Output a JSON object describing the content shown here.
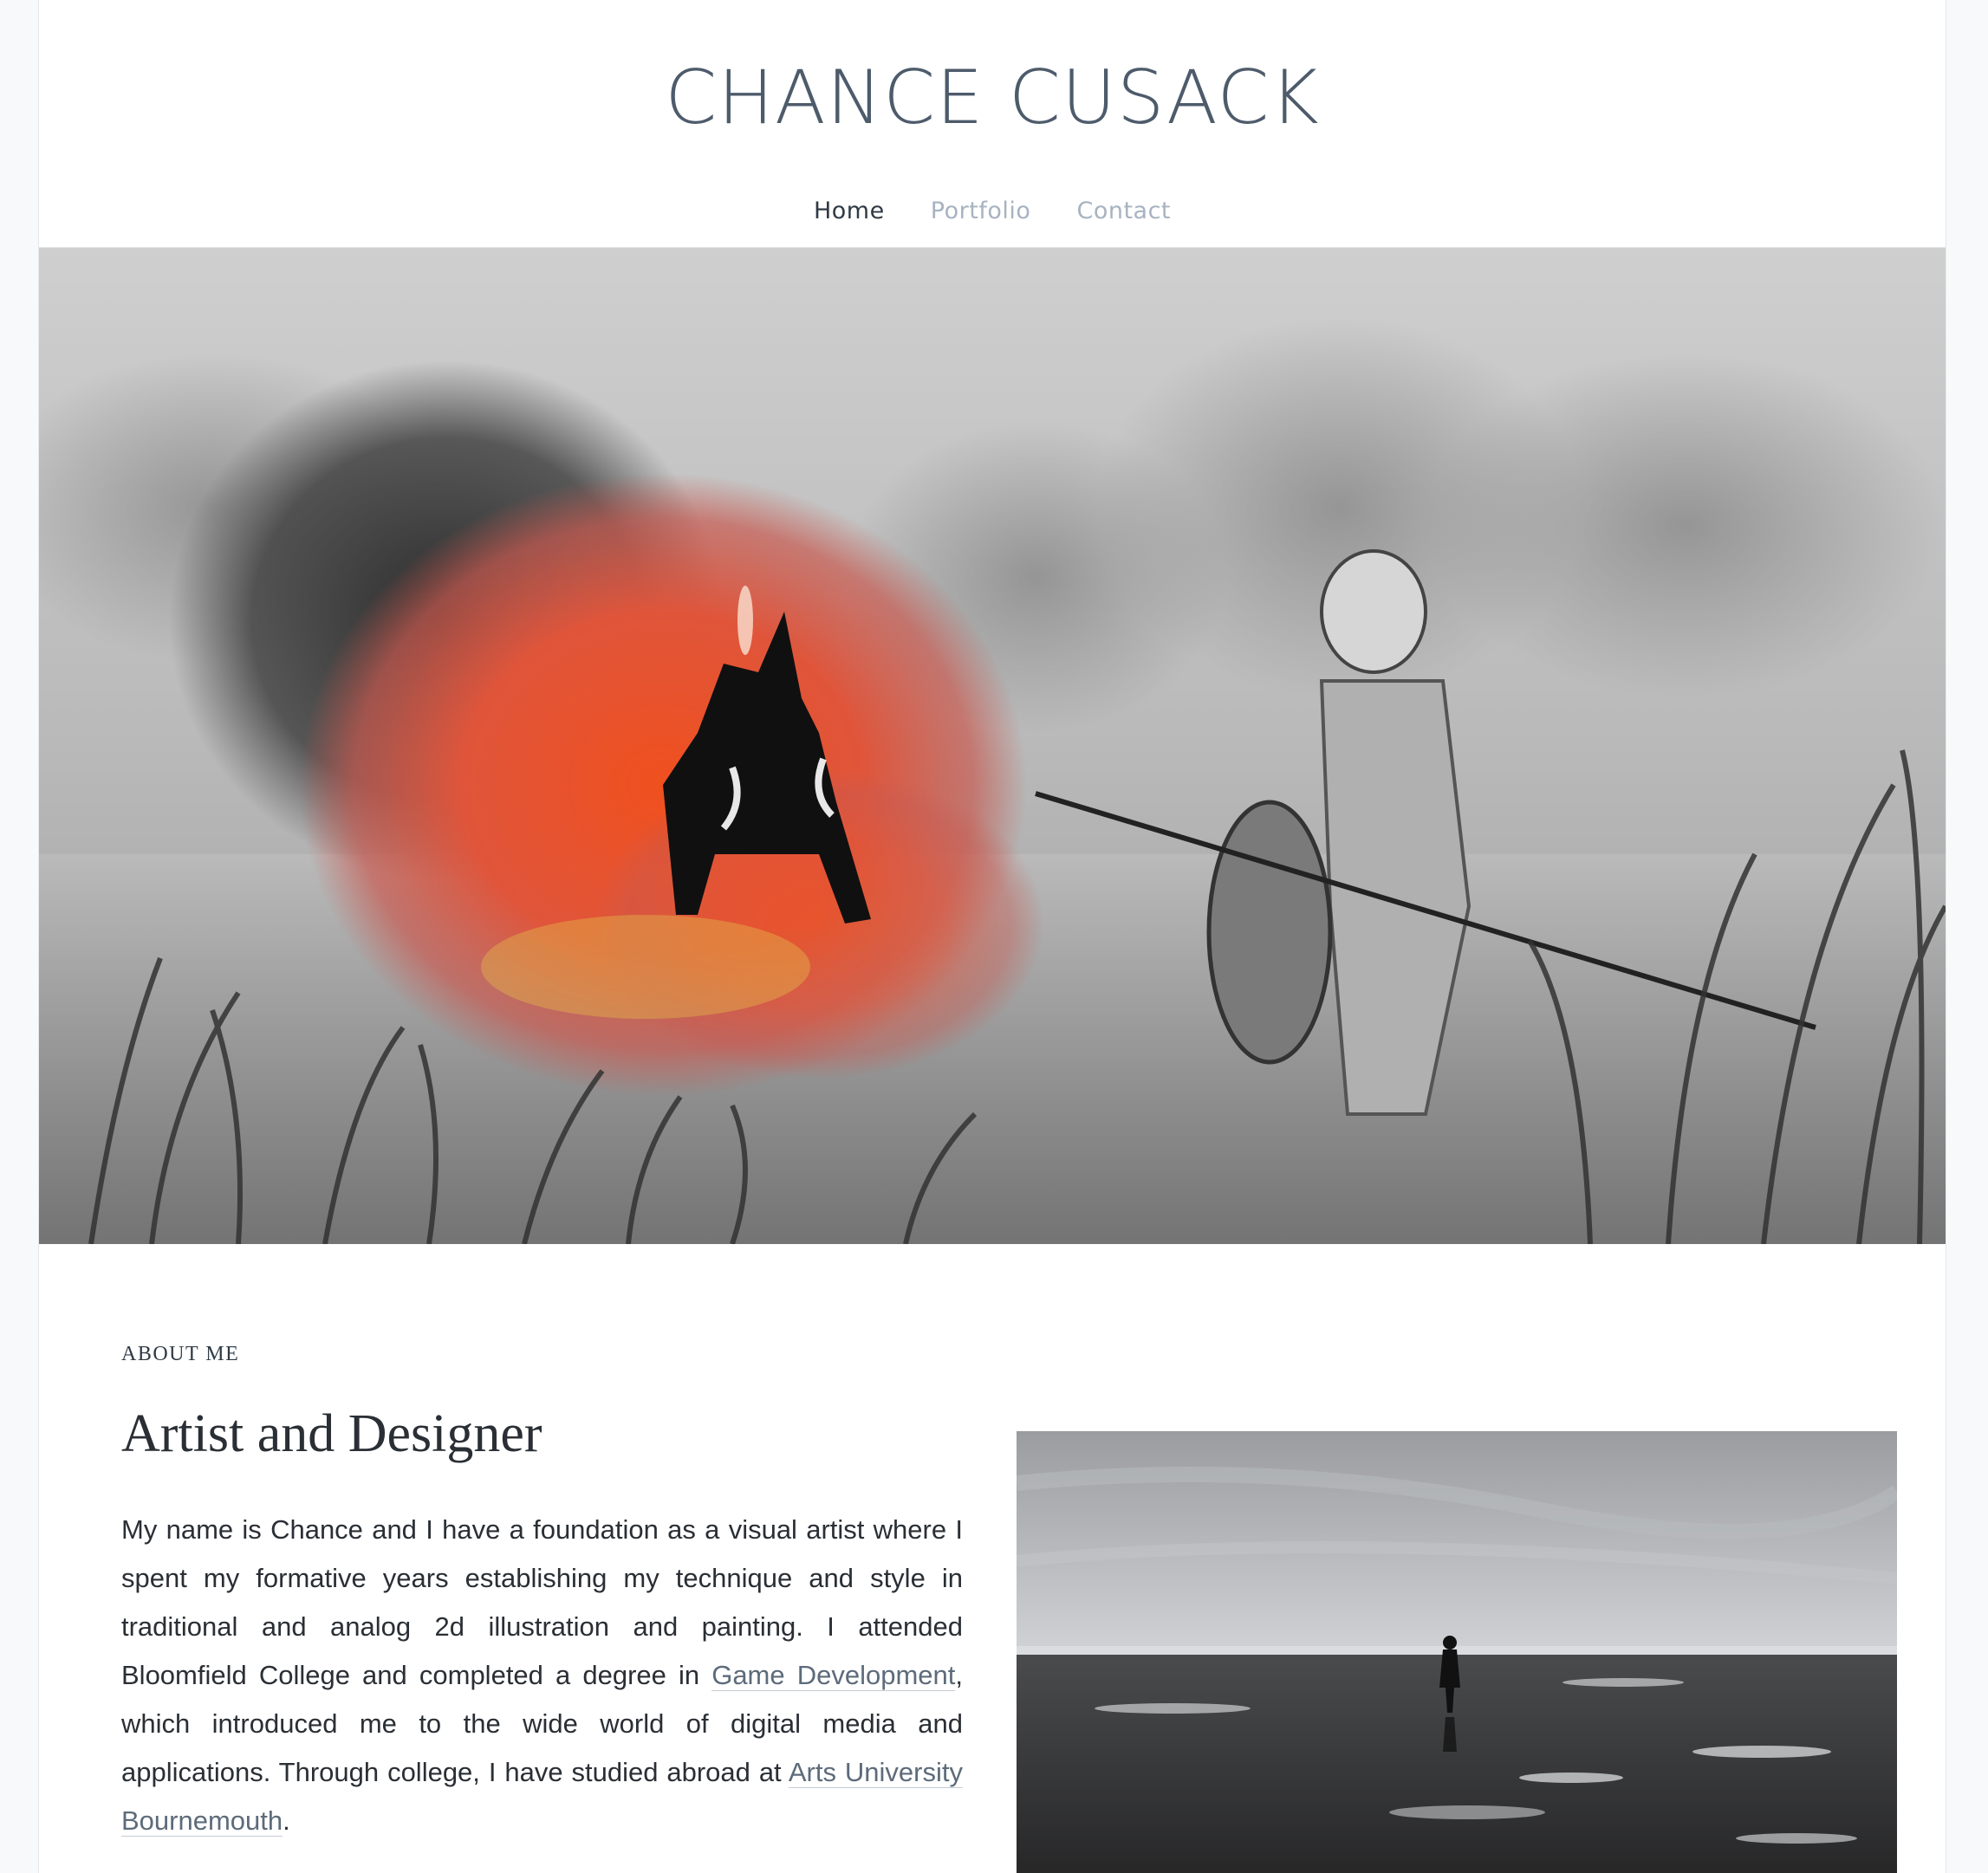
{
  "site": {
    "title": "CHANCE CUSACK"
  },
  "nav": {
    "items": [
      {
        "label": "Home",
        "active": true
      },
      {
        "label": "Portfolio",
        "active": false
      },
      {
        "label": "Contact",
        "active": false
      }
    ]
  },
  "hero": {
    "image": "hero-illustration"
  },
  "about": {
    "section_label": "ABOUT ME",
    "heading": "Artist and Designer",
    "paragraph_part1": "My name is Chance and I have a foundation as a visual artist where I spent my formative years establishing my technique and style in traditional and analog 2d illustration and painting. I attended Bloomfield College and completed a degree in ",
    "link1": "Game Development",
    "paragraph_part2": ", which introduced me to the wide world of digital media and applications. Through college, I have studied abroad at ",
    "link2": "Arts University Bournemouth",
    "paragraph_part3": ".",
    "photo": "beach-photo"
  },
  "colors": {
    "title": "#4d5b6b",
    "nav_active": "#2f3a45",
    "nav_inactive": "#a7b3c0",
    "link": "#5d6b7a",
    "accent_fire": "#e8522a"
  }
}
